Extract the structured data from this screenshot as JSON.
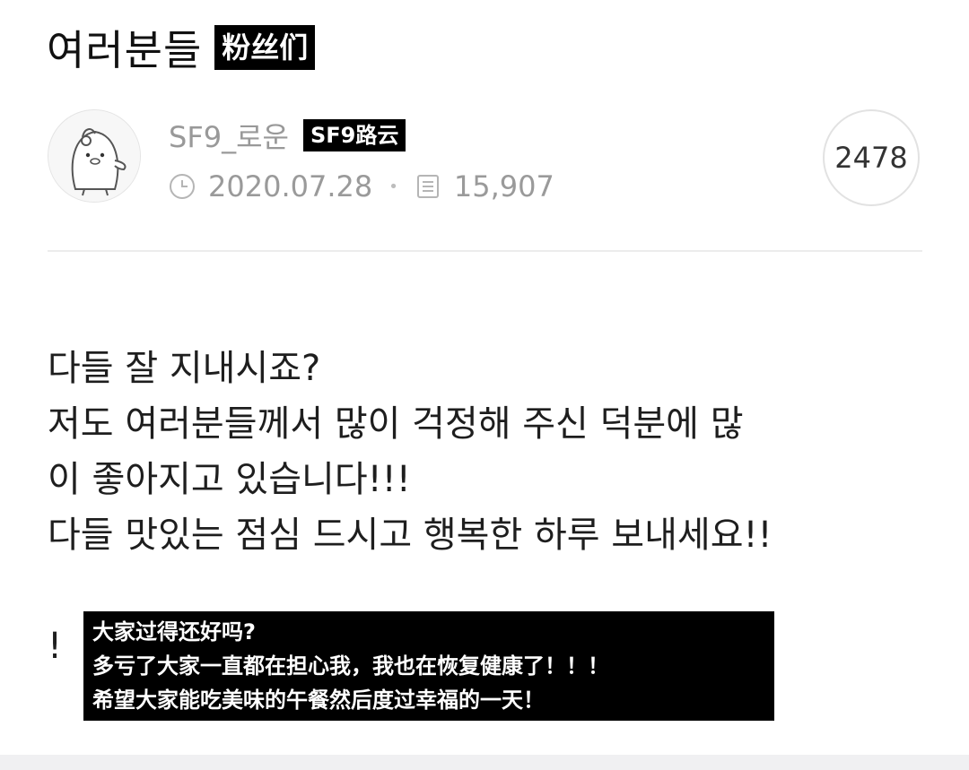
{
  "header": {
    "title": "여러분들",
    "title_translation": "粉丝们"
  },
  "post": {
    "author": "SF9_로운",
    "author_translation": "SF9路云",
    "date": "2020.07.28",
    "views": "15,907",
    "comment_count": "2478",
    "icons": {
      "avatar": "penguin-avatar",
      "date": "clock-icon",
      "views": "document-icon"
    },
    "body_lines": [
      "다들 잘 지내시죠?",
      "저도 여러분들께서 많이 걱정해 주신 덕분에 많",
      "이 좋아지고 있습니다!!!",
      "다들 맛있는 점심 드시고 행복한 하루 보내세요!!"
    ],
    "body_tail": "!"
  },
  "translation": {
    "lines": [
      "大家过得还好吗?",
      "多亏了大家一直都在担心我，我也在恢复健康了！！！",
      "希望大家能吃美味的午餐然后度过幸福的一天！"
    ]
  },
  "colors": {
    "tag_background": "#000000",
    "meta_text": "#9a9a9a",
    "divider": "#ececec"
  }
}
